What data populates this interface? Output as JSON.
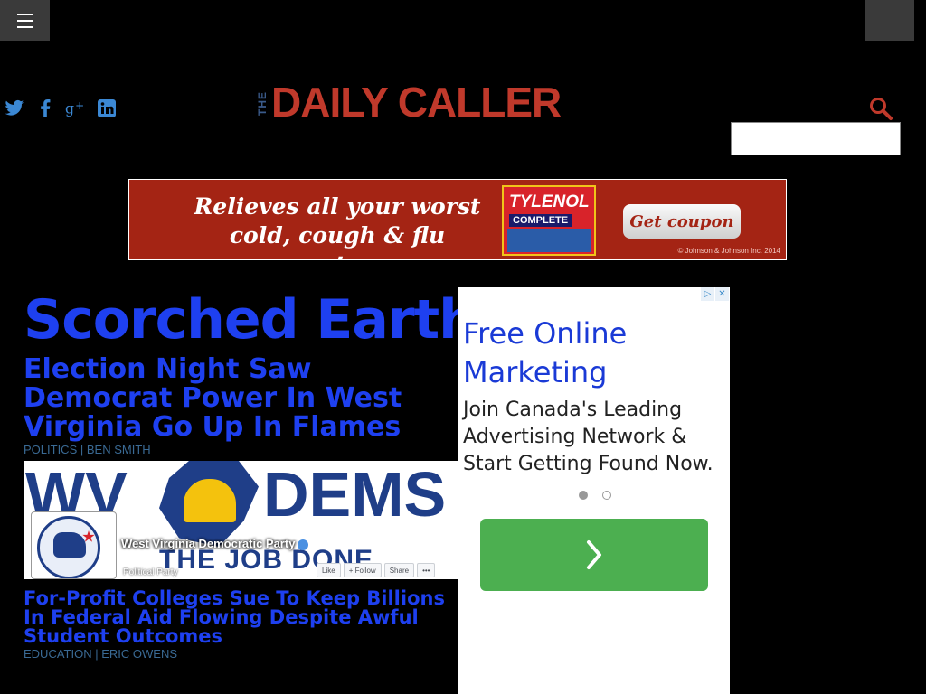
{
  "header": {
    "menu_icon": "hamburger-menu-icon",
    "social_icons": [
      "twitter-icon",
      "facebook-icon",
      "google-plus-icon",
      "linkedin-icon"
    ],
    "social_color": "#3b88d4",
    "logo_the": "THE",
    "logo_main": "DAILY CALLER",
    "logo_color": "#c0392b",
    "search_icon": "search-icon",
    "search_placeholder": ""
  },
  "banner_ad": {
    "headline_line1": "Relieves all your worst",
    "headline_line2": "cold, cough & flu symptoms.",
    "product_name": "TYLENOL",
    "product_sub": "COMPLETE",
    "button_label": "Get coupon",
    "legal": "© Johnson & Johnson Inc. 2014",
    "background_color": "#a42414"
  },
  "main": {
    "kicker": "Scorched Earth",
    "lead_story": {
      "title": "Election Night Saw Democrat Power In West Virginia Go Up In Flames",
      "category": "POLITICS",
      "separator": "|",
      "author": "BEN SMITH",
      "image": {
        "big_text_left": "WV",
        "big_text_right": "DEMS",
        "banner_text": "THE JOB DONE",
        "page_name": "West Virginia Democratic Party",
        "page_type": "Political Party",
        "buttons": [
          "Like",
          "+ Follow",
          "Share",
          "•••"
        ]
      }
    },
    "second_story": {
      "title": "For-Profit Colleges Sue To Keep Billions In Federal Aid Flowing Despite Awful Student Outcomes",
      "category": "EDUCATION",
      "separator": "|",
      "author": "ERIC OWENS"
    },
    "link_color": "#1e40f0"
  },
  "side_ad": {
    "headline": "Free Online Marketing",
    "body": "Join Canada's Leading Advertising Network & Start Getting Found Now.",
    "adchoices_icon": "adchoices-icon",
    "close_icon": "close-icon",
    "carousel_dots": 2,
    "active_dot": 0,
    "cta_icon": "chevron-right-icon",
    "cta_color": "#4caf50"
  }
}
